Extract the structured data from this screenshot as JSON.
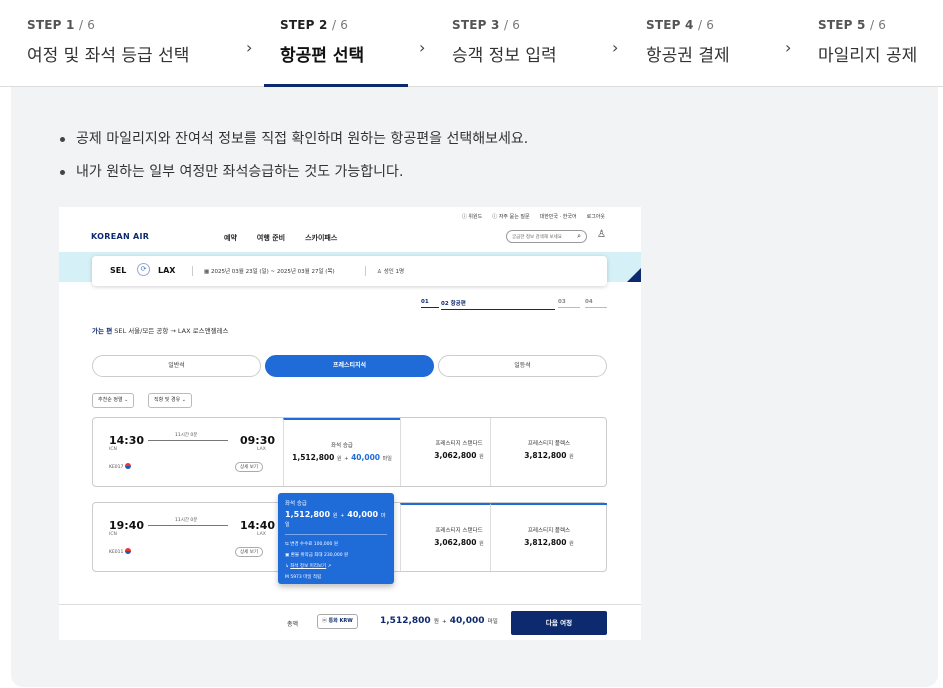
{
  "steps": [
    {
      "label": "STEP 1",
      "total": "/ 6",
      "name": "여정 및 좌석 등급 선택",
      "active": false
    },
    {
      "label": "STEP 2",
      "total": "/ 6",
      "name": "항공편 선택",
      "active": true
    },
    {
      "label": "STEP 3",
      "total": "/ 6",
      "name": "승객 정보 입력",
      "active": false
    },
    {
      "label": "STEP 4",
      "total": "/ 6",
      "name": "항공권 결제",
      "active": false
    },
    {
      "label": "STEP 5",
      "total": "/ 6",
      "name": "마일리지 공제",
      "active": false
    }
  ],
  "chevron": "›",
  "bullets": [
    "공제 마일리지와 잔여석 정보를 직접 확인하며 원하는 항공편을 선택해보세요.",
    "내가 원하는 일부 여정만 좌석승급하는 것도 가능합니다."
  ],
  "shot": {
    "util": [
      "ⓘ 위원드",
      "ⓘ 자주 묻는 질문",
      "대한민국 · 한국어",
      "로그아웃"
    ],
    "logo": "KOREAN AIR",
    "gnb": [
      "예약",
      "여행 준비",
      "스카이패스"
    ],
    "search_placeholder": "궁금한 정보 검색해 보세요",
    "route": {
      "from": "SEL",
      "to": "LAX",
      "dates": "2025년 03월 23일 (일) ~ 2025년 03월 27일 (목)",
      "pax": "성인 1명"
    },
    "mini_steps": {
      "s1": "01",
      "s2": "02 항공편",
      "s3": "03",
      "s4": "04"
    },
    "route_title": {
      "label": "가는 편",
      "text": "SEL 서울/모든 공항 → LAX 로스앤젤레스"
    },
    "cabins": [
      "일반석",
      "프레스티지석",
      "일등석"
    ],
    "filters": [
      "추천순 정렬 ⌄",
      "직항 및 경유 ⌄"
    ],
    "flights": [
      {
        "dep": "14:30",
        "arr": "09:30",
        "from": "ICN",
        "to": "LAX",
        "duration": "11시간 0분",
        "no": "KE017",
        "detail": "상세 보기",
        "c1_title": "좌석 승급",
        "c1_won": "1,512,800",
        "c1_mile": "40,000",
        "c2_title": "프레스티지 스탠다드",
        "c2_price": "3,062,800",
        "c3_title": "프레스티지 플렉스",
        "c3_price": "3,812,800"
      },
      {
        "dep": "19:40",
        "arr": "14:40",
        "from": "ICN",
        "to": "LAX",
        "duration": "11시간 0분",
        "no": "KE011",
        "detail": "상세 보기",
        "c2_title": "프레스티지 스탠다드",
        "c2_price": "3,062,800",
        "c3_title": "프레스티지 플렉스",
        "c3_price": "3,812,800"
      }
    ],
    "won": "원",
    "mile_unit": "마일",
    "plus": "+",
    "tooltip": {
      "title": "좌석 승급",
      "won": "1,512,800",
      "mile": "40,000",
      "rows": [
        "변경 수수료 100,000 원",
        "환불 위약금 최대 230,000 원",
        "좌석 정보 미리보기",
        "5973 마일 적립"
      ]
    },
    "bottom": {
      "total_label": "총액",
      "currency": "통화 KRW",
      "won": "1,512,800",
      "mile": "40,000",
      "next": "다음 여정"
    }
  },
  "colors": {
    "primary": "#0d2a6e",
    "accent": "#1f6bd8",
    "panel": "#f2f3f5"
  }
}
